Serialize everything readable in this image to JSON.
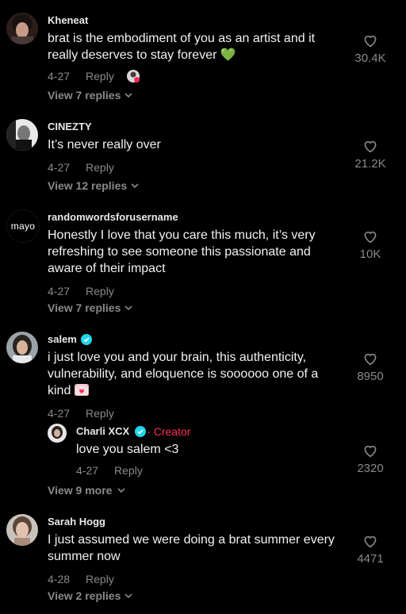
{
  "comments": [
    {
      "username": "Kheneat",
      "text": "brat is the embodiment of you as an artist and it really deserves to stay forever 💚",
      "date": "4-27",
      "reply_label": "Reply",
      "likes": "30.4K",
      "view_replies": "View 7 replies"
    },
    {
      "username": "CINEZTY",
      "text": "It’s never really over",
      "date": "4-27",
      "reply_label": "Reply",
      "likes": "21.2K",
      "view_replies": "View 12 replies"
    },
    {
      "username": "randomwordsforusername",
      "avatar_text": "mayo",
      "text": "Honestly I love that you care this much, it’s very refreshing to see someone this passionate and aware of their impact",
      "date": "4-27",
      "reply_label": "Reply",
      "likes": "10K",
      "view_replies": "View 7 replies"
    },
    {
      "username": "salem",
      "text": "i just love you and your brain, this authenticity, vulnerability, and eloquence is soooooo one of a kind",
      "date": "4-27",
      "reply_label": "Reply",
      "likes": "8950",
      "reply": {
        "username": "Charli XCX",
        "badge": "· Creator",
        "text": "love you salem <3",
        "date": "4-27",
        "reply_label": "Reply",
        "likes": "2320"
      },
      "view_more": "View 9 more"
    },
    {
      "username": "Sarah Hogg",
      "text": "I just assumed we were doing a brat summer every summer now",
      "date": "4-28",
      "reply_label": "Reply",
      "likes": "4471",
      "view_replies": "View 2 replies"
    }
  ],
  "colors": {
    "background": "#000000",
    "muted": "#8a8a8a",
    "verified": "#20d5ec",
    "creator": "#fe2c55",
    "green_heart": "#5bd84a"
  }
}
